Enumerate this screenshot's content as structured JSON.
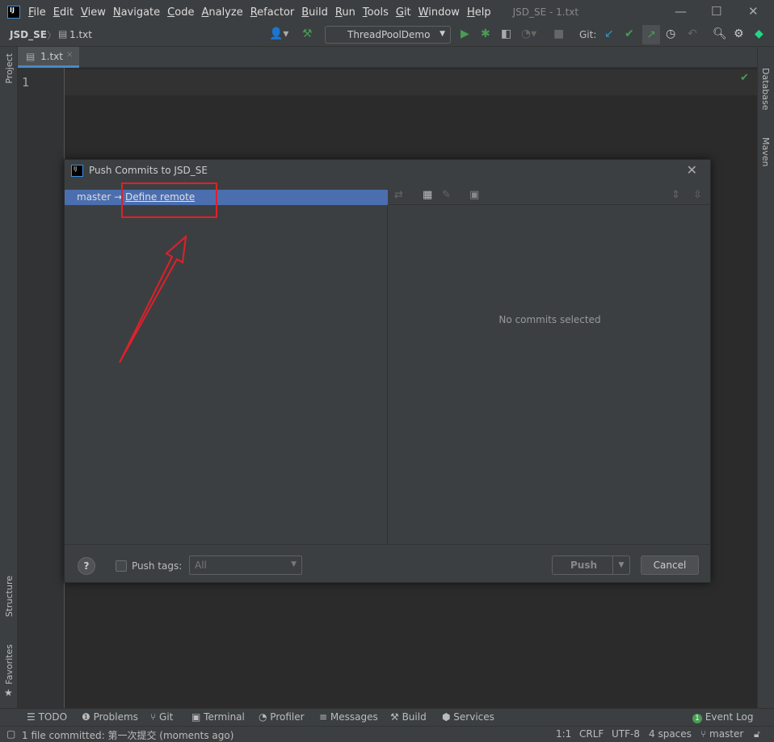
{
  "app": {
    "title": "JSD_SE - 1.txt",
    "logo": "IJ"
  },
  "menu": [
    "File",
    "Edit",
    "View",
    "Navigate",
    "Code",
    "Analyze",
    "Refactor",
    "Build",
    "Run",
    "Tools",
    "Git",
    "Window",
    "Help"
  ],
  "breadcrumb": {
    "project": "JSD_SE",
    "file": "1.txt"
  },
  "toolbar": {
    "run_config": "ThreadPoolDemo",
    "git_label": "Git:"
  },
  "left_strip": {
    "project": "Project",
    "structure": "Structure",
    "favorites": "Favorites"
  },
  "right_strip": {
    "database": "Database",
    "maven": "Maven"
  },
  "editor": {
    "tab": "1.txt",
    "line_number": "1"
  },
  "dialog": {
    "title": "Push Commits to JSD_SE",
    "branch": "master",
    "arrow": "→",
    "define_remote": "Define remote",
    "empty_text": "No commits selected",
    "help": "?",
    "push_tags_label": "Push tags:",
    "push_tags_value": "All",
    "push_tags_checked": false,
    "push": "Push",
    "cancel": "Cancel"
  },
  "toolwindows": [
    "TODO",
    "Problems",
    "Git",
    "Terminal",
    "Profiler",
    "Messages",
    "Build",
    "Services"
  ],
  "event_log": {
    "label": "Event Log",
    "count": "1"
  },
  "status": {
    "message": "1 file committed: 第一次提交 (moments ago)",
    "position": "1:1",
    "line_sep": "CRLF",
    "encoding": "UTF-8",
    "indent": "4 spaces",
    "branch": "master"
  },
  "colors": {
    "accent": "#4b6eaf",
    "annotation": "#e0202a",
    "run": "#499c54"
  }
}
